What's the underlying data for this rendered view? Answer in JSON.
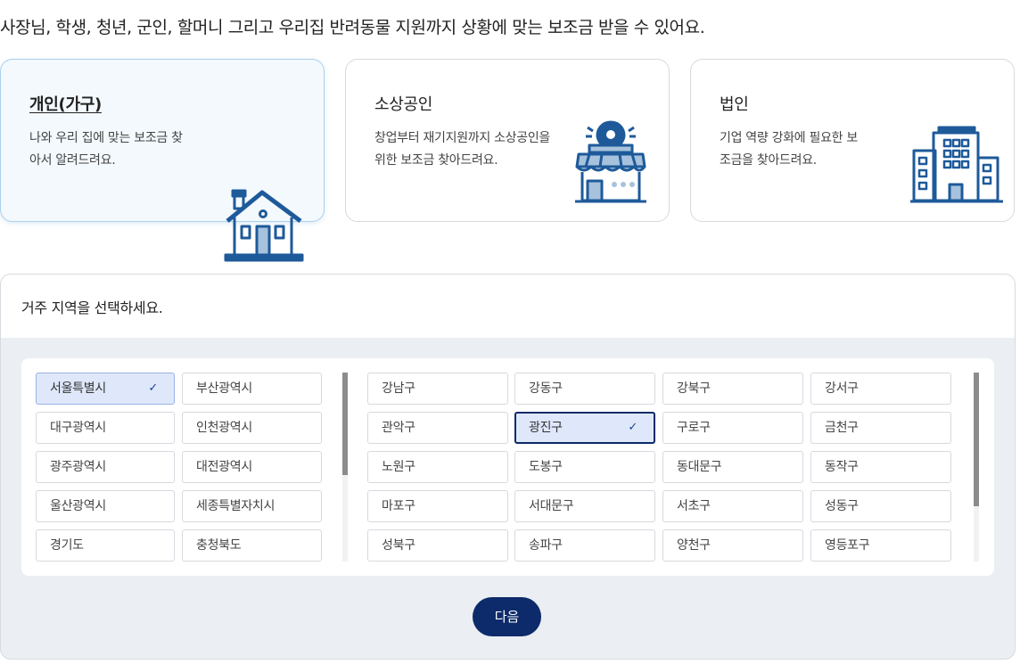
{
  "headline": "사장님, 학생, 청년, 군인, 할머니 그리고 우리집 반려동물 지원까지 상황에 맞는 보조금 받을 수 있어요.",
  "cards": [
    {
      "title": "개인(가구)",
      "desc": "나와 우리 집에 맞는 보조금 찾아서 알려드려요.",
      "icon": "house-icon",
      "selected": true
    },
    {
      "title": "소상공인",
      "desc": "창업부터 재기지원까지 소상공인을 위한 보조금 찾아드려요.",
      "icon": "storefront-icon",
      "selected": false
    },
    {
      "title": "법인",
      "desc": "기업 역량 강화에 필요한 보조금을 찾아드려요.",
      "icon": "office-building-icon",
      "selected": false
    }
  ],
  "region": {
    "title": "거주 지역을 선택하세요.",
    "check_icon": "✓",
    "provinces": [
      "서울특별시",
      "부산광역시",
      "대구광역시",
      "인천광역시",
      "광주광역시",
      "대전광역시",
      "울산광역시",
      "세종특별자치시",
      "경기도",
      "충청북도"
    ],
    "selected_province": "서울특별시",
    "districts": [
      "강남구",
      "강동구",
      "강북구",
      "강서구",
      "관악구",
      "광진구",
      "구로구",
      "금천구",
      "노원구",
      "도봉구",
      "동대문구",
      "동작구",
      "마포구",
      "서대문구",
      "서초구",
      "성동구",
      "성북구",
      "송파구",
      "양천구",
      "영등포구"
    ],
    "selected_district": "광진구"
  },
  "next_label": "다음",
  "colors": {
    "icon": "#1e5a9a",
    "primary": "#0d2b6b",
    "selected_bg": "#dfe8fb"
  }
}
